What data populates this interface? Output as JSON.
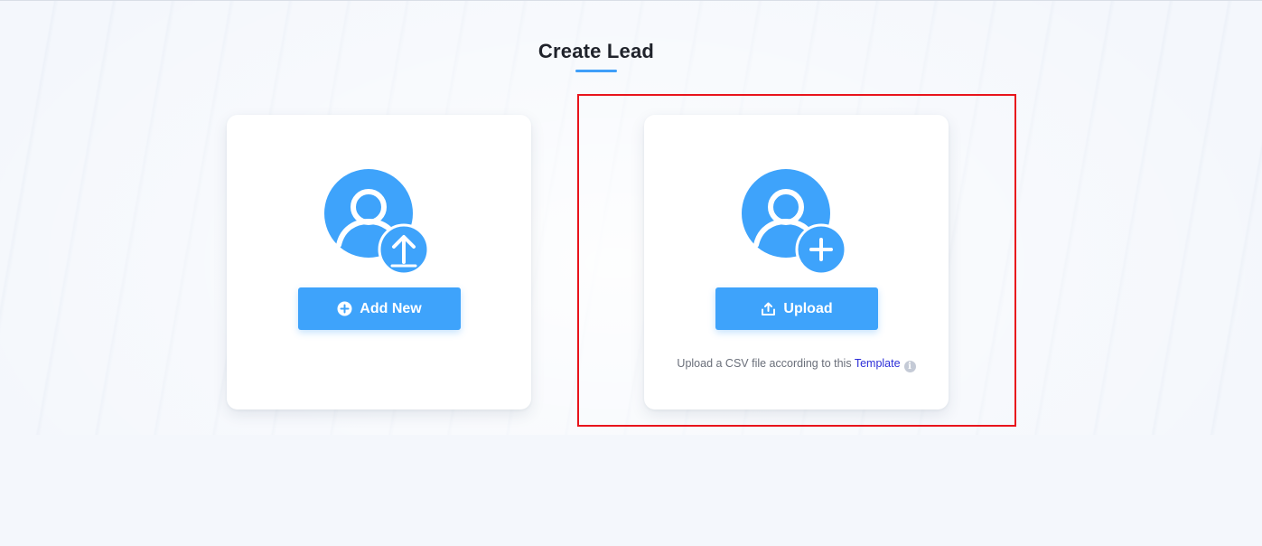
{
  "page": {
    "title": "Create Lead"
  },
  "cards": {
    "add_new": {
      "button_label": "Add New",
      "avatar_icon": "user-upload-icon",
      "button_icon": "plus-circle-icon"
    },
    "upload": {
      "button_label": "Upload",
      "avatar_icon": "user-add-icon",
      "button_icon": "upload-icon",
      "note_prefix": "Upload a CSV file according to this",
      "template_link": "Template",
      "info_icon_glyph": "i"
    }
  },
  "colors": {
    "accent": "#3ea3fb",
    "link": "#2d2fd8",
    "highlight": "#e8141c",
    "background": "#f4f7fc"
  }
}
